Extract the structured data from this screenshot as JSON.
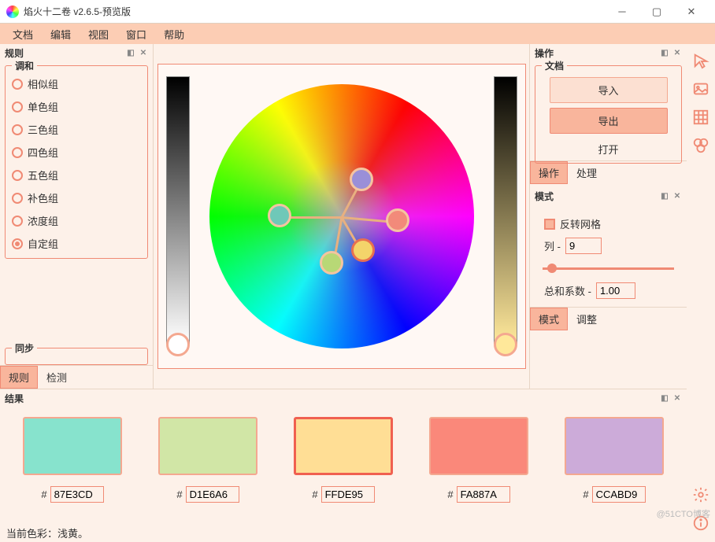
{
  "title": "焰火十二卷 v2.6.5-预览版",
  "menus": [
    "文档",
    "编辑",
    "视图",
    "窗口",
    "帮助"
  ],
  "left": {
    "header": "规则",
    "group": "调和",
    "options": [
      "相似组",
      "单色组",
      "三色组",
      "四色组",
      "五色组",
      "补色组",
      "浓度组",
      "自定组"
    ],
    "selected": 7,
    "sync": "同步",
    "tabs": [
      "规则",
      "检测"
    ],
    "active_tab": 0
  },
  "right": {
    "header_ops": "操作",
    "group_doc": "文档",
    "btn_import": "导入",
    "btn_export": "导出",
    "btn_open": "打开",
    "tabs1": [
      "操作",
      "处理"
    ],
    "active_tab1": 0,
    "header_mode": "模式",
    "invert": "反转网格",
    "col_label": "列 -",
    "col_val": "9",
    "sum_label": "总和系数 -",
    "sum_val": "1.00",
    "tabs2": [
      "模式",
      "调整"
    ],
    "active_tab2": 0
  },
  "results": {
    "header": "结果",
    "swatches": [
      {
        "color": "#87E3CD",
        "hex": "87E3CD",
        "sel": false
      },
      {
        "color": "#D1E6A6",
        "hex": "D1E6A6",
        "sel": false
      },
      {
        "color": "#FFDE95",
        "hex": "FFDE95",
        "sel": true
      },
      {
        "color": "#FA887A",
        "hex": "FA887A",
        "sel": false
      },
      {
        "color": "#CCABD9",
        "hex": "CCABD9",
        "sel": false
      }
    ]
  },
  "status": "当前色彩：浅黄。",
  "watermark": "@51CTO博客",
  "tools": [
    "cursor",
    "image",
    "grid",
    "shapes",
    "settings",
    "info"
  ]
}
